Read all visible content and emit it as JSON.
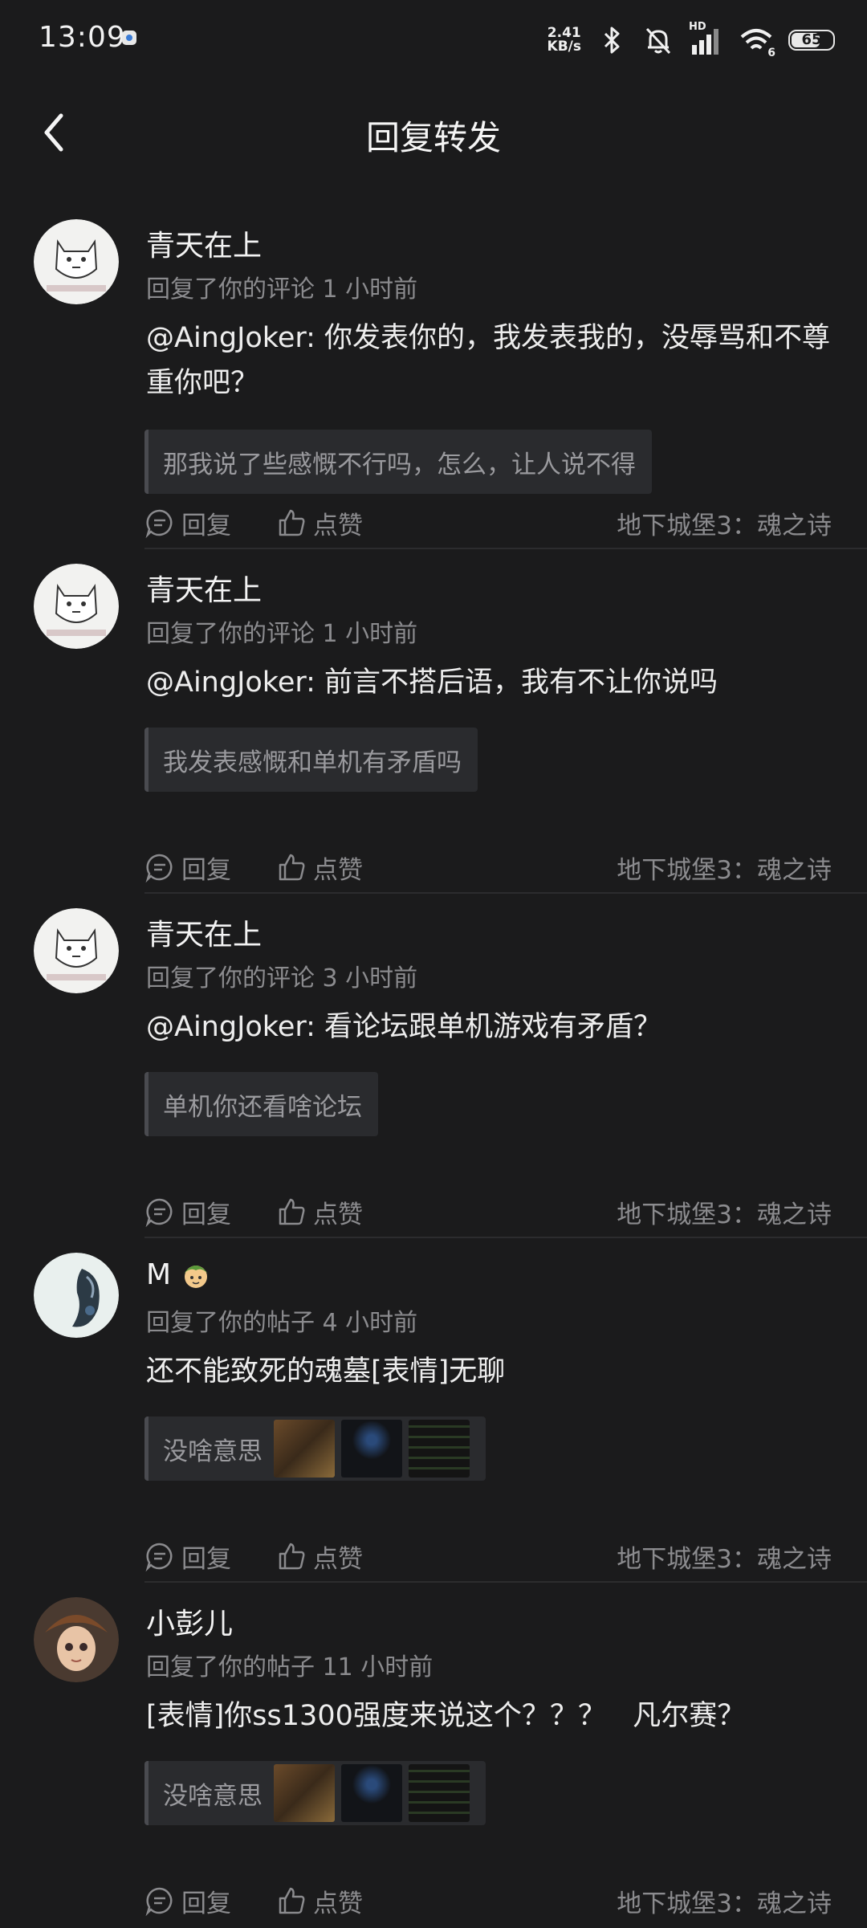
{
  "status_bar": {
    "time": "13:09",
    "net_speed_value": "2.41",
    "net_speed_unit": "KB/s",
    "signal_label": "HD",
    "wifi_label": "6",
    "battery": "65"
  },
  "nav": {
    "title": "回复转发"
  },
  "actions": {
    "reply": "回复",
    "like": "点赞"
  },
  "items": [
    {
      "user": "青天在上",
      "meta": "回复了你的评论 1 小时前",
      "content": "@AingJoker: 你发表你的，我发表我的，没辱骂和不尊重你吧？",
      "quote": "那我说了些感慨不行吗，怎么，让人说不得",
      "game": "地下城堡3：魂之诗"
    },
    {
      "user": "青天在上",
      "meta": "回复了你的评论 1 小时前",
      "content": "@AingJoker: 前言不搭后语，我有不让你说吗",
      "quote": "我发表感慨和单机有矛盾吗",
      "game": "地下城堡3：魂之诗"
    },
    {
      "user": "青天在上",
      "meta": "回复了你的评论 3 小时前",
      "content": "@AingJoker: 看论坛跟单机游戏有矛盾？",
      "quote": "单机你还看啥论坛",
      "game": "地下城堡3：魂之诗"
    },
    {
      "user": "M",
      "meta": "回复了你的帖子 4 小时前",
      "content": "还不能致死的魂墓[表情]无聊",
      "quote": "没啥意思",
      "game": "地下城堡3：魂之诗"
    },
    {
      "user": "小彭儿",
      "meta": "回复了你的帖子 11 小时前",
      "content": "[表情]你ss1300强度来说这个？？？   凡尔赛？",
      "quote": "没啥意思",
      "game": "地下城堡3：魂之诗"
    }
  ]
}
